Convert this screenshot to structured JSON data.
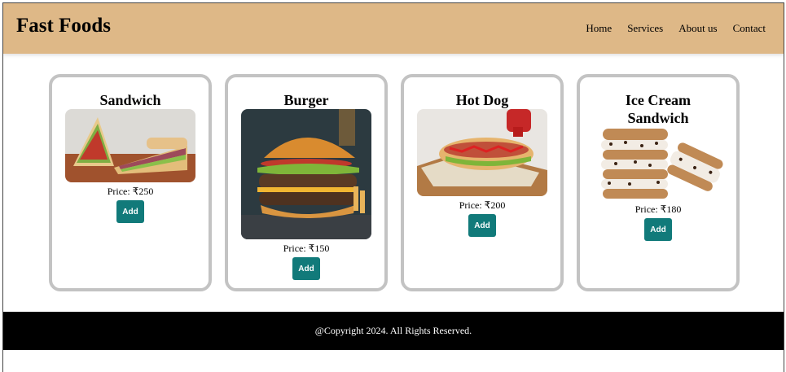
{
  "header": {
    "logo": "Fast Foods",
    "nav": [
      "Home",
      "Services",
      "About us",
      "Contact"
    ]
  },
  "products": [
    {
      "name": "Sandwich",
      "price": "Price: ₹250",
      "button": "Add"
    },
    {
      "name": "Burger",
      "price": "Price: ₹150",
      "button": "Add"
    },
    {
      "name": "Hot Dog",
      "price": "Price: ₹200",
      "button": "Add"
    },
    {
      "name": "Ice Cream Sandwich",
      "price": "Price: ₹180",
      "button": "Add"
    }
  ],
  "footer": {
    "copyright": "@Copyright 2024. All Rights Reserved."
  },
  "colors": {
    "header_bg": "#deb887",
    "button_bg": "#117a7a",
    "footer_bg": "#000000",
    "card_border": "#c3c3c3"
  }
}
